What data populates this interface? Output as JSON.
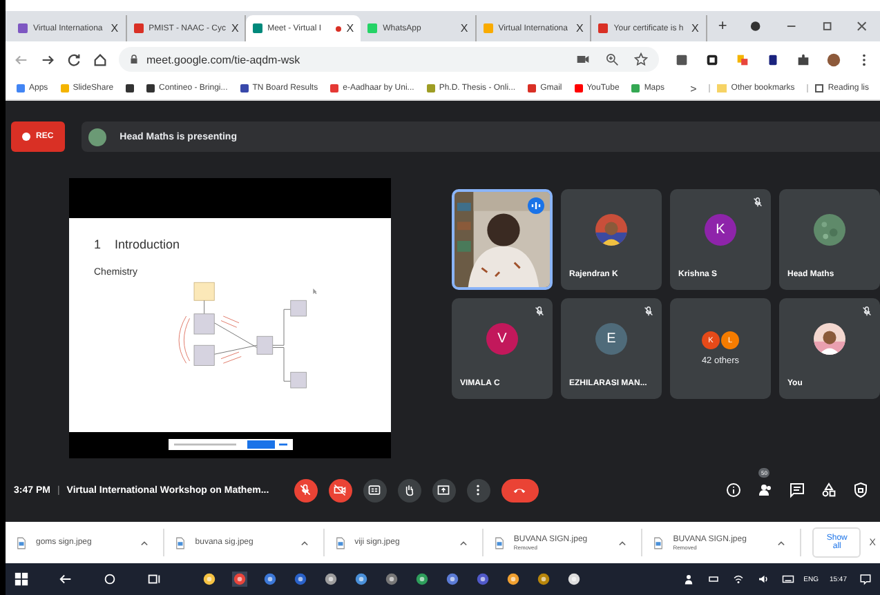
{
  "browser": {
    "tabs": [
      {
        "title": "Virtual Internationa",
        "color": "#7e57c2",
        "close": "X",
        "selected": false
      },
      {
        "title": "PMIST - NAAC - Cyc",
        "color": "#d93025",
        "close": "X",
        "selected": false
      },
      {
        "title": "Meet - Virtual I",
        "color": "#00897b",
        "close": "X",
        "selected": true
      },
      {
        "title": "WhatsApp",
        "color": "#25d366",
        "close": "X",
        "selected": false
      },
      {
        "title": "Virtual Internationa",
        "color": "#f9ab00",
        "close": "X",
        "selected": false
      },
      {
        "title": "Your certificate is h",
        "color": "#d93025",
        "close": "X",
        "selected": false
      }
    ],
    "new_tab": "+",
    "address": "meet.google.com/tie-aqdm-wsk",
    "bookmarks": [
      {
        "label": "Apps",
        "color": "#4285f4"
      },
      {
        "label": "SlideShare",
        "color": "#f4b400"
      },
      {
        "color": "#333333"
      },
      {
        "label": "Contineo - Bringi...",
        "color": "#333333"
      },
      {
        "label": "TN Board Results",
        "color": "#3949ab"
      },
      {
        "label": "e-Aadhaar by Uni...",
        "color": "#e53935"
      },
      {
        "label": "Ph.D. Thesis - Onli...",
        "color": "#9e9d24"
      },
      {
        "label": "Gmail",
        "color": "#d93025"
      },
      {
        "label": "YouTube",
        "color": "#ff0000"
      },
      {
        "label": "Maps",
        "color": "#34a853"
      }
    ],
    "overflow": ">",
    "other_bookmarks": "Other bookmarks",
    "reading_list": "Reading lis"
  },
  "meet": {
    "rec": "REC",
    "presenting": "Head Maths is presenting",
    "slide": {
      "number": "1",
      "title": "Introduction",
      "subtitle": "Chemistry"
    },
    "tiles": [
      {
        "kind": "video",
        "speaking": true
      },
      {
        "name": "Rajendran K",
        "muted": false
      },
      {
        "kind": "letter",
        "name": "Krishna S",
        "letter": "K",
        "color": "#8e24aa",
        "muted": true
      },
      {
        "kind": "pattern",
        "name": "Head Maths",
        "muted": false
      },
      {
        "kind": "letter",
        "name": "VIMALA C",
        "letter": "V",
        "color": "#c2185b",
        "muted": true
      },
      {
        "kind": "letter",
        "name": "EZHILARASI MAN...",
        "letter": "E",
        "color": "#4f6b7a",
        "muted": true
      },
      {
        "kind": "others",
        "name": "42 others",
        "letters": [
          {
            "letter": "K",
            "color": "#e64a19"
          },
          {
            "letter": "L",
            "color": "#f57c00"
          }
        ],
        "muted": false
      },
      {
        "name": "You",
        "muted": true
      }
    ],
    "time": "3:47 PM",
    "separator": "|",
    "meeting_title": "Virtual International Workshop on Mathem...",
    "controls": [
      {
        "kind": "mic",
        "off": true
      },
      {
        "kind": "camera",
        "off": true
      },
      {
        "kind": "captions",
        "off": false
      },
      {
        "kind": "hand",
        "off": false
      },
      {
        "kind": "present",
        "off": false
      },
      {
        "kind": "more",
        "off": false
      },
      {
        "kind": "end"
      }
    ],
    "side_buttons": [
      {
        "kind": "info"
      },
      {
        "kind": "people",
        "badge": "50"
      },
      {
        "kind": "chat"
      },
      {
        "kind": "activities"
      },
      {
        "kind": "host"
      }
    ]
  },
  "downloads": {
    "items": [
      {
        "name": "goms sign.jpeg"
      },
      {
        "name": "buvana sig.jpeg"
      },
      {
        "name": "viji sign.jpeg"
      },
      {
        "name": "BUVANA SIGN.jpeg",
        "status": "Removed"
      },
      {
        "name": "BUVANA SIGN.jpeg",
        "status": "Removed"
      }
    ],
    "show_all": "Show all",
    "close": "X"
  },
  "taskbar": {
    "lang": "ENG",
    "time": "15:47"
  }
}
